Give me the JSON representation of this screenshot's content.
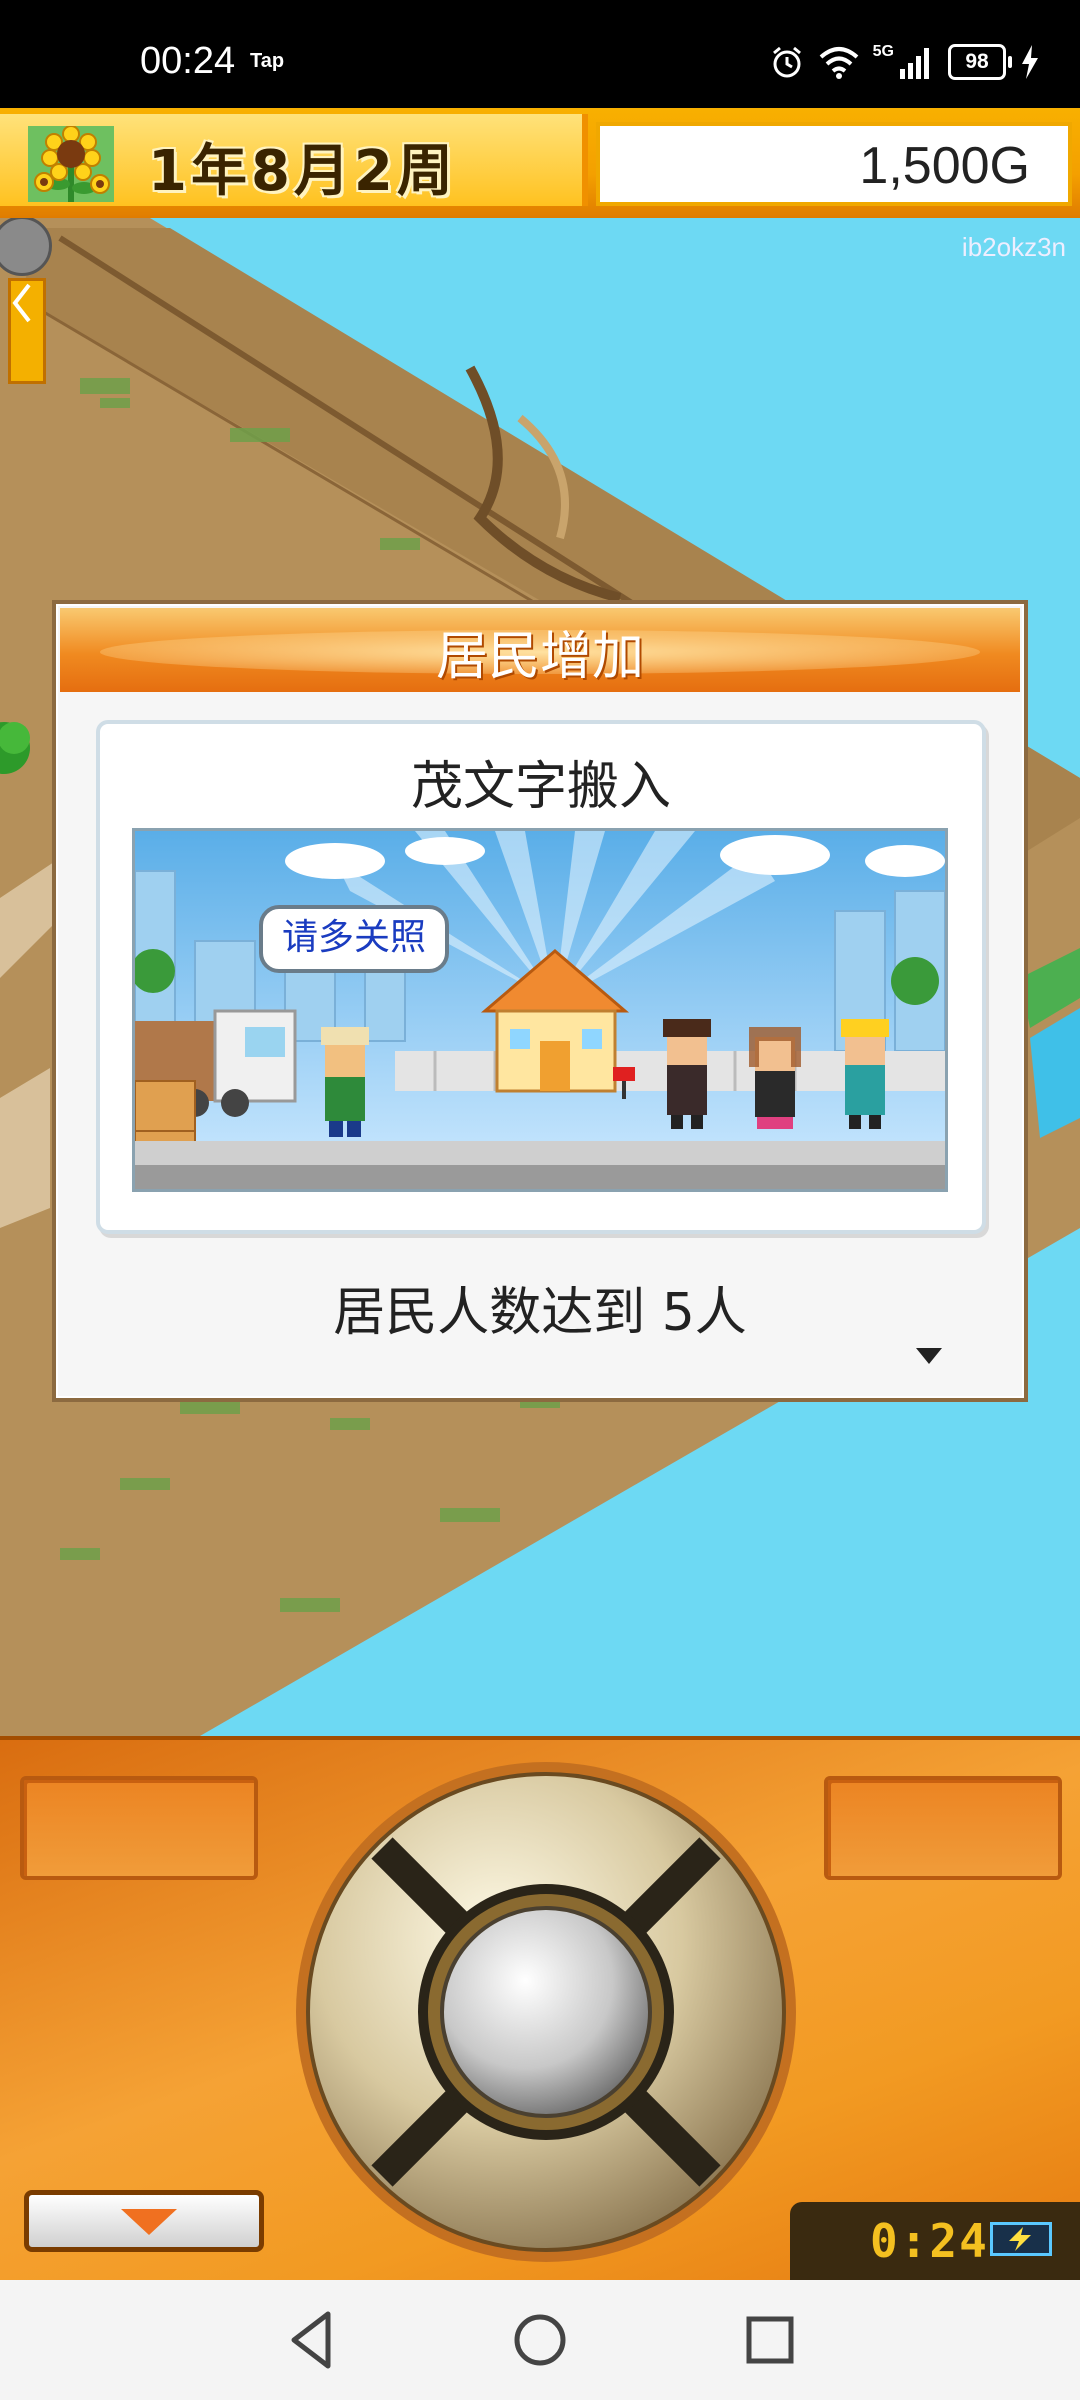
{
  "status_bar": {
    "time": "00:24",
    "tap_label": "Tap",
    "network": "5G",
    "battery": "98",
    "icons": [
      "alarm-icon",
      "wifi-icon",
      "signal-icon",
      "battery-icon",
      "charging-icon"
    ]
  },
  "game_header": {
    "date": "1年8月2周",
    "money": "1,500G"
  },
  "map": {
    "watermark": "ib2okz3n"
  },
  "dialog": {
    "title": "居民增加",
    "subtitle": "茂文字搬入",
    "speech": "请多关照",
    "message": "居民人数达到 5人"
  },
  "controls": {
    "timer": "0:24"
  },
  "colors": {
    "water": "#6dd9f3",
    "ground": "#b5905a",
    "panel_orange": "#f29a22",
    "dialog_header": "#f08a20"
  }
}
